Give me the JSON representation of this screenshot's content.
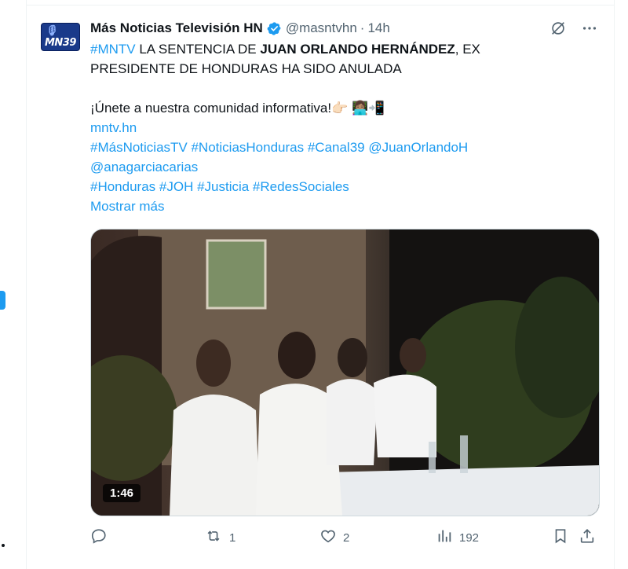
{
  "tweet": {
    "display_name": "Más Noticias Televisión HN",
    "handle": "@masntvhn",
    "separator": "·",
    "time": "14h",
    "avatar_text": "MN39",
    "text": {
      "hashtag_mntv": "#MNTV",
      "line1_a": " LA SENTENCIA DE ",
      "line1_bold": "JUAN ORLANDO HERNÁNDEZ",
      "line1_b": ", EX",
      "line2": "PRESIDENTE DE HONDURAS HA SIDO ANULADA",
      "line3": "¡Únete a nuestra comunidad informativa!👉🏻 👩🏽‍💻📲",
      "link": "mntv.hn",
      "tags_line1": "#MásNoticiasTV #NoticiasHonduras #Canal39 @JuanOrlandoH",
      "tags_line2": "@anagarciacarias",
      "tags_line3": "#Honduras #JOH #Justicia #RedesSociales",
      "show_more": "Mostrar más"
    },
    "video": {
      "duration": "1:46"
    },
    "metrics": {
      "replies": "",
      "retweets": "1",
      "likes": "2",
      "views": "192"
    }
  },
  "colors": {
    "accent": "#1d9bf0",
    "text": "#0f1419",
    "muted": "#536471"
  },
  "icons": [
    "verified-badge-icon",
    "grok-icon",
    "more-icon",
    "reply-icon",
    "retweet-icon",
    "like-icon",
    "views-icon",
    "bookmark-icon",
    "share-icon"
  ]
}
